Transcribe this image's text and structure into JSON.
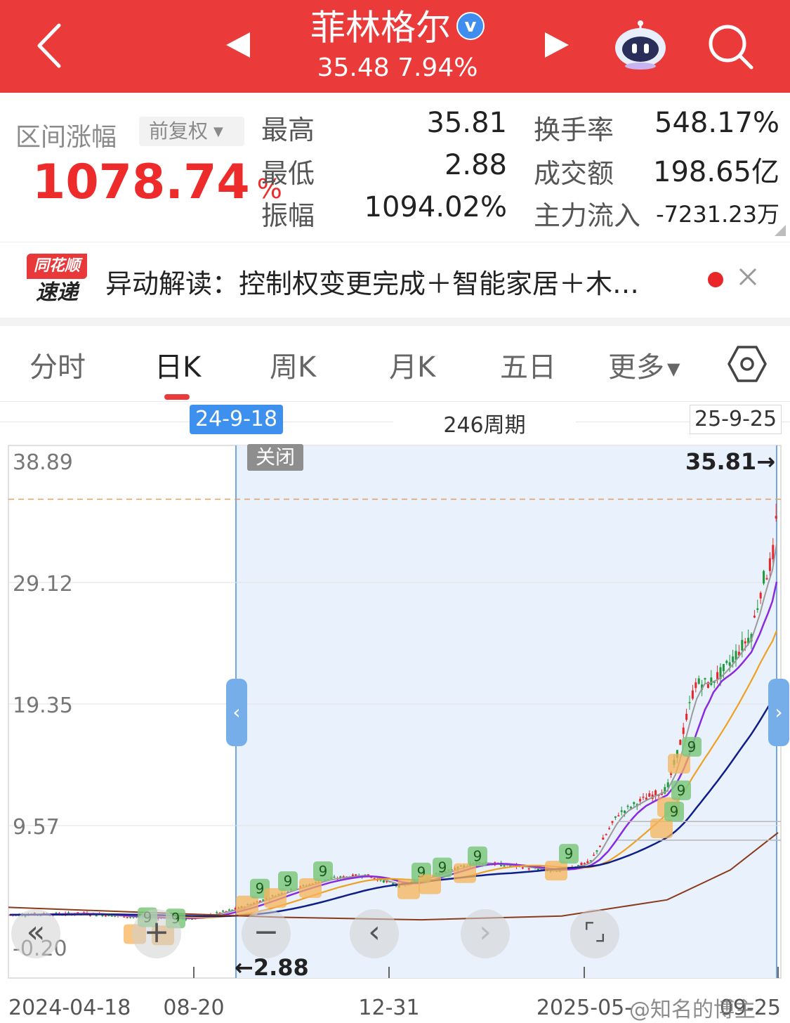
{
  "header": {
    "stock_name": "菲林格尔",
    "verified_mark": "v",
    "quote": "35.48 7.94%",
    "colors": {
      "background": "#ea3a3a",
      "text": "#ffffff"
    },
    "icons": [
      "back-icon",
      "prev-stock-icon",
      "next-stock-icon",
      "robot-assistant-icon",
      "search-icon"
    ]
  },
  "stats": {
    "range_label": "区间涨幅",
    "adjust_label": "前复权",
    "range_change_value": "1078.74",
    "range_change_unit": "%",
    "high_label": "最高",
    "high_value": "35.81",
    "low_label": "最低",
    "low_value": "2.88",
    "amplitude_label": "振幅",
    "amplitude_value": "1094.02%",
    "turnover_label": "换手率",
    "turnover_value": "548.17%",
    "amount_label": "成交额",
    "amount_value": "198.65亿",
    "mainflow_label": "主力流入",
    "mainflow_value": "-7231.23万",
    "accent_color": "#ee2b2b"
  },
  "banner": {
    "logo_top": "同花顺",
    "logo_bottom": "速递",
    "text": "异动解读：控制权变更完成＋智能家居＋木…"
  },
  "tabs": [
    {
      "label": "分时",
      "active": false
    },
    {
      "label": "日K",
      "active": true
    },
    {
      "label": "周K",
      "active": false
    },
    {
      "label": "月K",
      "active": false
    },
    {
      "label": "五日",
      "active": false
    },
    {
      "label": "更多",
      "active": false
    }
  ],
  "period": {
    "start_date": "24-9-18",
    "count": "246周期",
    "end_date": "25-9-25"
  },
  "chart": {
    "close_label": "关闭",
    "high_marker": "35.81→",
    "low_marker": "←2.88",
    "y_ticks": [
      "38.89",
      "29.12",
      "19.35",
      "9.57",
      "-0.20"
    ],
    "x_ticks": [
      "2024-04-18",
      "08-20",
      "12-31",
      "2025-05-",
      "09-25"
    ],
    "watermark": "@知名的博主",
    "selection_color": "#e8f1fc",
    "ma_colors": [
      "#9a9a9a",
      "#8a2be2",
      "#f0a020",
      "#101e8a",
      "#8b3a1a"
    ]
  },
  "chart_data": {
    "type": "line",
    "title": "",
    "x": [
      "2024-04-18",
      "08-20",
      "09-18",
      "12-31",
      "2025-05-",
      "09-25"
    ],
    "ylim": [
      -0.2,
      38.89
    ],
    "y_ticks": [
      38.89,
      29.12,
      19.35,
      9.57,
      -0.2
    ],
    "series": [
      {
        "name": "",
        "values": [
          2.5,
          2.9,
          2.88,
          4.6,
          5.4,
          35.48
        ]
      }
    ],
    "high": 35.81,
    "low": 2.88
  }
}
